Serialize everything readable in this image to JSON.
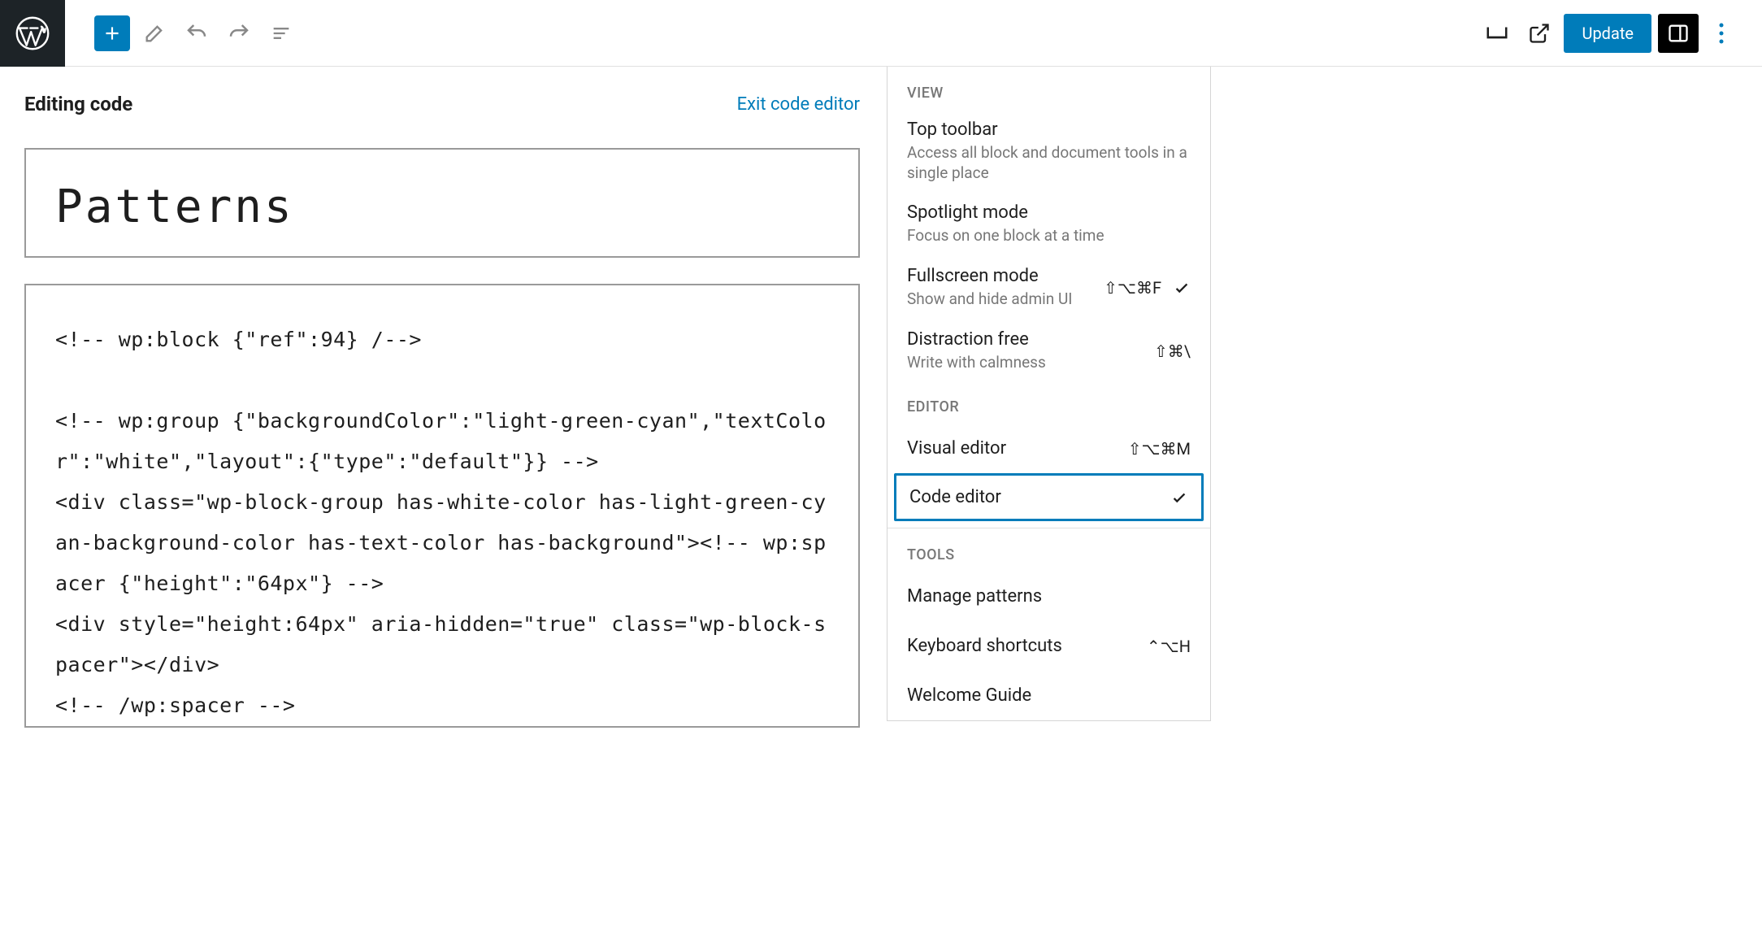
{
  "toolbar": {
    "update_label": "Update"
  },
  "editor": {
    "editing_label": "Editing code",
    "exit_link": "Exit code editor",
    "title": "Patterns",
    "code": "<!-- wp:block {\"ref\":94} /-->\n\n<!-- wp:group {\"backgroundColor\":\"light-green-cyan\",\"textColor\":\"white\",\"layout\":{\"type\":\"default\"}} -->\n<div class=\"wp-block-group has-white-color has-light-green-cyan-background-color has-text-color has-background\"><!-- wp:spacer {\"height\":\"64px\"} -->\n<div style=\"height:64px\" aria-hidden=\"true\" class=\"wp-block-spacer\"></div>\n<!-- /wp:spacer -->"
  },
  "menu": {
    "sections": {
      "view": "VIEW",
      "editor": "EDITOR",
      "tools": "TOOLS"
    },
    "items": {
      "top_toolbar": {
        "title": "Top toolbar",
        "desc": "Access all block and document tools in a single place"
      },
      "spotlight": {
        "title": "Spotlight mode",
        "desc": "Focus on one block at a time"
      },
      "fullscreen": {
        "title": "Fullscreen mode",
        "desc": "Show and hide admin UI",
        "shortcut": "⇧⌥⌘F",
        "checked": true
      },
      "distraction": {
        "title": "Distraction free",
        "desc": "Write with calmness",
        "shortcut": "⇧⌘\\"
      },
      "visual": {
        "title": "Visual editor",
        "shortcut": "⇧⌥⌘M"
      },
      "code": {
        "title": "Code editor",
        "checked": true
      },
      "manage_patterns": {
        "title": "Manage patterns"
      },
      "keyboard_shortcuts": {
        "title": "Keyboard shortcuts",
        "shortcut": "⌃⌥H"
      },
      "welcome_guide": {
        "title": "Welcome Guide"
      }
    }
  }
}
